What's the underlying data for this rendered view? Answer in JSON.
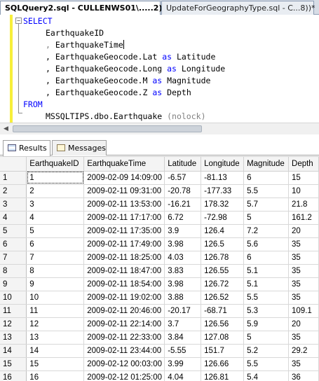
{
  "tabs": [
    {
      "label": "SQLQuery2.sql - CULLENWS01\\.....2))*",
      "active": true
    },
    {
      "label": "UpdateForGeographyType.sql - C...8))*",
      "active": false
    }
  ],
  "sql": {
    "select": "SELECT",
    "col1": "EarthquakeID",
    "col2": ", EarthquakeTime",
    "col3_expr": ", EarthquakeGeocode.Lat",
    "col3_as": "as",
    "col3_alias": "Latitude",
    "col4_expr": ", EarthquakeGeocode.Long",
    "col4_as": "as",
    "col4_alias": "Longitude",
    "col5_expr": ", EarthquakeGeocode.M",
    "col5_as": "as",
    "col5_alias": "Magnitude",
    "col6_expr": ", EarthquakeGeocode.Z",
    "col6_as": "as",
    "col6_alias": "Depth",
    "from": "FROM",
    "table": "MSSQLTIPS.dbo.Earthquake",
    "hint": "(nolock)"
  },
  "result_tabs": [
    {
      "label": "Results",
      "icon": "grid-icon",
      "active": true
    },
    {
      "label": "Messages",
      "icon": "messages-icon",
      "active": false
    }
  ],
  "columns": [
    "",
    "EarthquakeID",
    "EarthquakeTime",
    "Latitude",
    "Longitude",
    "Magnitude",
    "Depth"
  ],
  "rows": [
    [
      "1",
      "1",
      "2009-02-09 14:09:00",
      "-6.57",
      "-81.13",
      "6",
      "15"
    ],
    [
      "2",
      "2",
      "2009-02-11 09:31:00",
      "-20.78",
      "-177.33",
      "5.5",
      "10"
    ],
    [
      "3",
      "3",
      "2009-02-11 13:53:00",
      "-16.21",
      "178.32",
      "5.7",
      "21.8"
    ],
    [
      "4",
      "4",
      "2009-02-11 17:17:00",
      "6.72",
      "-72.98",
      "5",
      "161.2"
    ],
    [
      "5",
      "5",
      "2009-02-11 17:35:00",
      "3.9",
      "126.4",
      "7.2",
      "20"
    ],
    [
      "6",
      "6",
      "2009-02-11 17:49:00",
      "3.98",
      "126.5",
      "5.6",
      "35"
    ],
    [
      "7",
      "7",
      "2009-02-11 18:25:00",
      "4.03",
      "126.78",
      "6",
      "35"
    ],
    [
      "8",
      "8",
      "2009-02-11 18:47:00",
      "3.83",
      "126.55",
      "5.1",
      "35"
    ],
    [
      "9",
      "9",
      "2009-02-11 18:54:00",
      "3.98",
      "126.72",
      "5.1",
      "35"
    ],
    [
      "10",
      "10",
      "2009-02-11 19:02:00",
      "3.88",
      "126.52",
      "5.5",
      "35"
    ],
    [
      "11",
      "11",
      "2009-02-11 20:46:00",
      "-20.17",
      "-68.71",
      "5.3",
      "109.1"
    ],
    [
      "12",
      "12",
      "2009-02-11 22:14:00",
      "3.7",
      "126.56",
      "5.9",
      "20"
    ],
    [
      "13",
      "13",
      "2009-02-11 22:33:00",
      "3.84",
      "127.08",
      "5",
      "35"
    ],
    [
      "14",
      "14",
      "2009-02-11 23:44:00",
      "-5.55",
      "151.7",
      "5.2",
      "29.2"
    ],
    [
      "15",
      "15",
      "2009-02-12 00:03:00",
      "3.99",
      "126.66",
      "5.5",
      "35"
    ],
    [
      "16",
      "16",
      "2009-02-12 01:25:00",
      "4.04",
      "126.81",
      "5.4",
      "36"
    ]
  ]
}
